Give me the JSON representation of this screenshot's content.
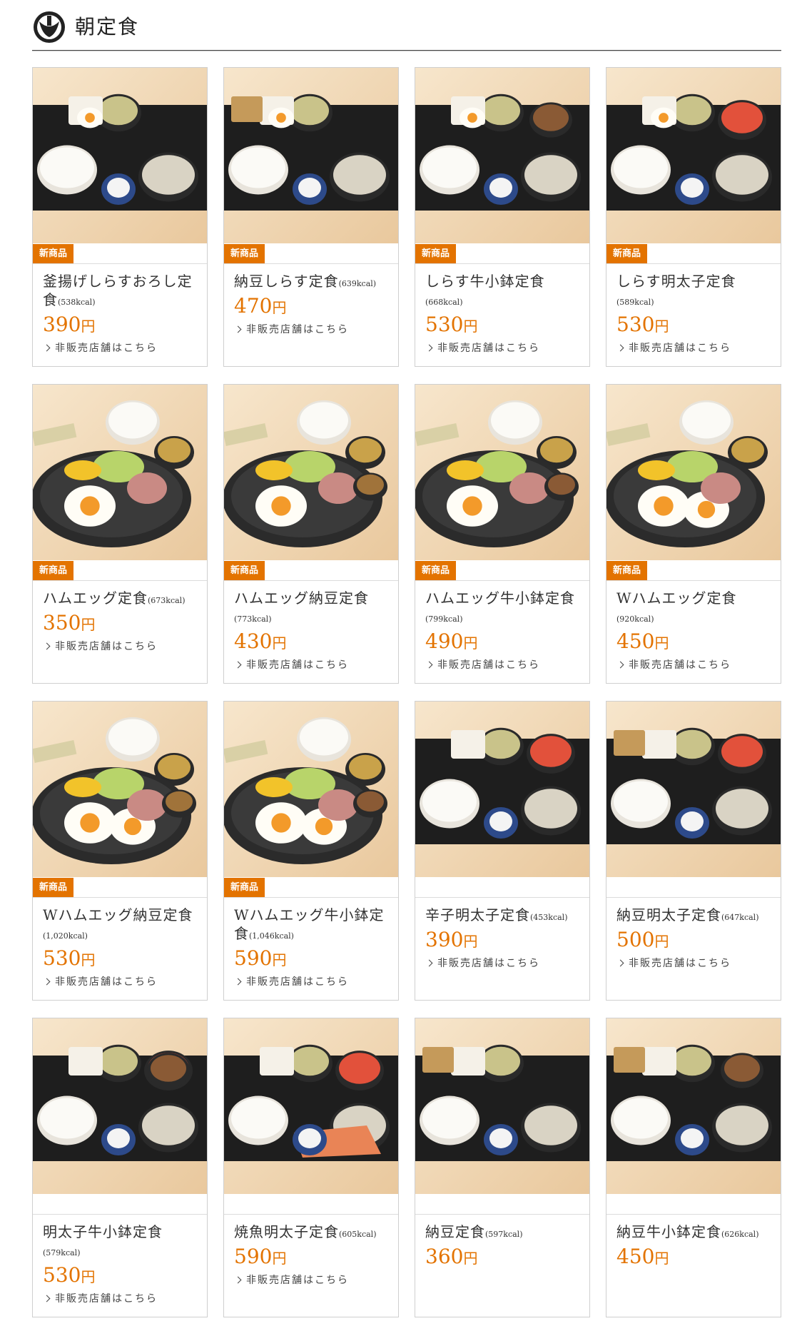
{
  "header": {
    "title": "朝定食"
  },
  "colors": {
    "accent": "#e37300"
  },
  "items": [
    {
      "name": "釜揚げしらすおろし定食",
      "kcal": "(538kcal)",
      "kcal_newline": false,
      "price": "390",
      "yen": "円",
      "badge": "新商品",
      "link": "非販売店舗はこちら",
      "photo": "tray-shirasu-egg"
    },
    {
      "name": "納豆しらす定食",
      "kcal": "(639kcal)",
      "kcal_newline": false,
      "price": "470",
      "yen": "円",
      "badge": "新商品",
      "link": "非販売店舗はこちら",
      "photo": "tray-shirasu-natto"
    },
    {
      "name": "しらす牛小鉢定食",
      "kcal": "(668kcal)",
      "kcal_newline": true,
      "price": "530",
      "yen": "円",
      "badge": "新商品",
      "link": "非販売店舗はこちら",
      "photo": "tray-shirasu-beef"
    },
    {
      "name": "しらす明太子定食",
      "kcal": "(589kcal)",
      "kcal_newline": true,
      "price": "530",
      "yen": "円",
      "badge": "新商品",
      "link": "非販売店舗はこちら",
      "photo": "tray-shirasu-mentaiko"
    },
    {
      "name": "ハムエッグ定食",
      "kcal": "(673kcal)",
      "kcal_newline": false,
      "price": "350",
      "yen": "円",
      "badge": "新商品",
      "link": "非販売店舗はこちら",
      "photo": "pan-hamegg"
    },
    {
      "name": "ハムエッグ納豆定食",
      "kcal": "(773kcal)",
      "kcal_newline": true,
      "price": "430",
      "yen": "円",
      "badge": "新商品",
      "link": "非販売店舗はこちら",
      "photo": "pan-hamegg-natto"
    },
    {
      "name": "ハムエッグ牛小鉢定食",
      "kcal": "(799kcal)",
      "kcal_newline": false,
      "price": "490",
      "yen": "円",
      "badge": "新商品",
      "link": "非販売店舗はこちら",
      "photo": "pan-hamegg-beef"
    },
    {
      "name": "Wハムエッグ定食",
      "kcal": "(920kcal)",
      "kcal_newline": true,
      "price": "450",
      "yen": "円",
      "badge": "新商品",
      "link": "非販売店舗はこちら",
      "photo": "pan-double"
    },
    {
      "name": "Wハムエッグ納豆定食",
      "kcal": "(1,020kcal)",
      "kcal_newline": false,
      "price": "530",
      "yen": "円",
      "badge": "新商品",
      "link": "非販売店舗はこちら",
      "photo": "pan-double-natto"
    },
    {
      "name": "Wハムエッグ牛小鉢定食",
      "kcal": "(1,046kcal)",
      "kcal_newline": false,
      "price": "590",
      "yen": "円",
      "badge": "新商品",
      "link": "非販売店舗はこちら",
      "photo": "pan-double-beef"
    },
    {
      "name": "辛子明太子定食",
      "kcal": "(453kcal)",
      "kcal_newline": false,
      "price": "390",
      "yen": "円",
      "badge": "",
      "link": "非販売店舗はこちら",
      "photo": "tray-mentaiko"
    },
    {
      "name": "納豆明太子定食",
      "kcal": "(647kcal)",
      "kcal_newline": false,
      "price": "500",
      "yen": "円",
      "badge": "",
      "link": "非販売店舗はこちら",
      "photo": "tray-natto-mentaiko"
    },
    {
      "name": "明太子牛小鉢定食",
      "kcal": "(579kcal)",
      "kcal_newline": true,
      "price": "530",
      "yen": "円",
      "badge": "",
      "link": "非販売店舗はこちら",
      "photo": "tray-mentaiko-beef"
    },
    {
      "name": "焼魚明太子定食",
      "kcal": "(605kcal)",
      "kcal_newline": false,
      "price": "590",
      "yen": "円",
      "badge": "",
      "link": "非販売店舗はこちら",
      "photo": "tray-salmon"
    },
    {
      "name": "納豆定食",
      "kcal": "(597kcal)",
      "kcal_newline": false,
      "price": "360",
      "yen": "円",
      "badge": "",
      "link": "",
      "photo": "tray-natto"
    },
    {
      "name": "納豆牛小鉢定食",
      "kcal": "(626kcal)",
      "kcal_newline": false,
      "price": "450",
      "yen": "円",
      "badge": "",
      "link": "",
      "photo": "tray-natto-beef"
    }
  ]
}
